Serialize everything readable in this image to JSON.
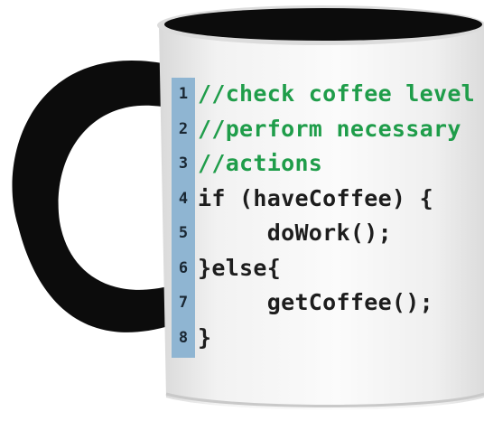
{
  "colors": {
    "comment": "#1f9d4a",
    "code": "#1d1d1d",
    "gutter": "#8fb5d2",
    "mug_body": "#f4f4f4",
    "mug_handle": "#0c0c0c",
    "mug_interior": "#0c0c0c"
  },
  "code_lines": [
    {
      "num": "1",
      "text": "//check coffee level",
      "kind": "comment"
    },
    {
      "num": "2",
      "text": "//perform necessary",
      "kind": "comment"
    },
    {
      "num": "3",
      "text": "//actions",
      "kind": "comment"
    },
    {
      "num": "4",
      "text": "if (haveCoffee) {",
      "kind": "code"
    },
    {
      "num": "5",
      "text": "     doWork();",
      "kind": "code"
    },
    {
      "num": "6",
      "text": "}else{",
      "kind": "code"
    },
    {
      "num": "7",
      "text": "     getCoffee();",
      "kind": "code"
    },
    {
      "num": "8",
      "text": "}",
      "kind": "code"
    }
  ]
}
